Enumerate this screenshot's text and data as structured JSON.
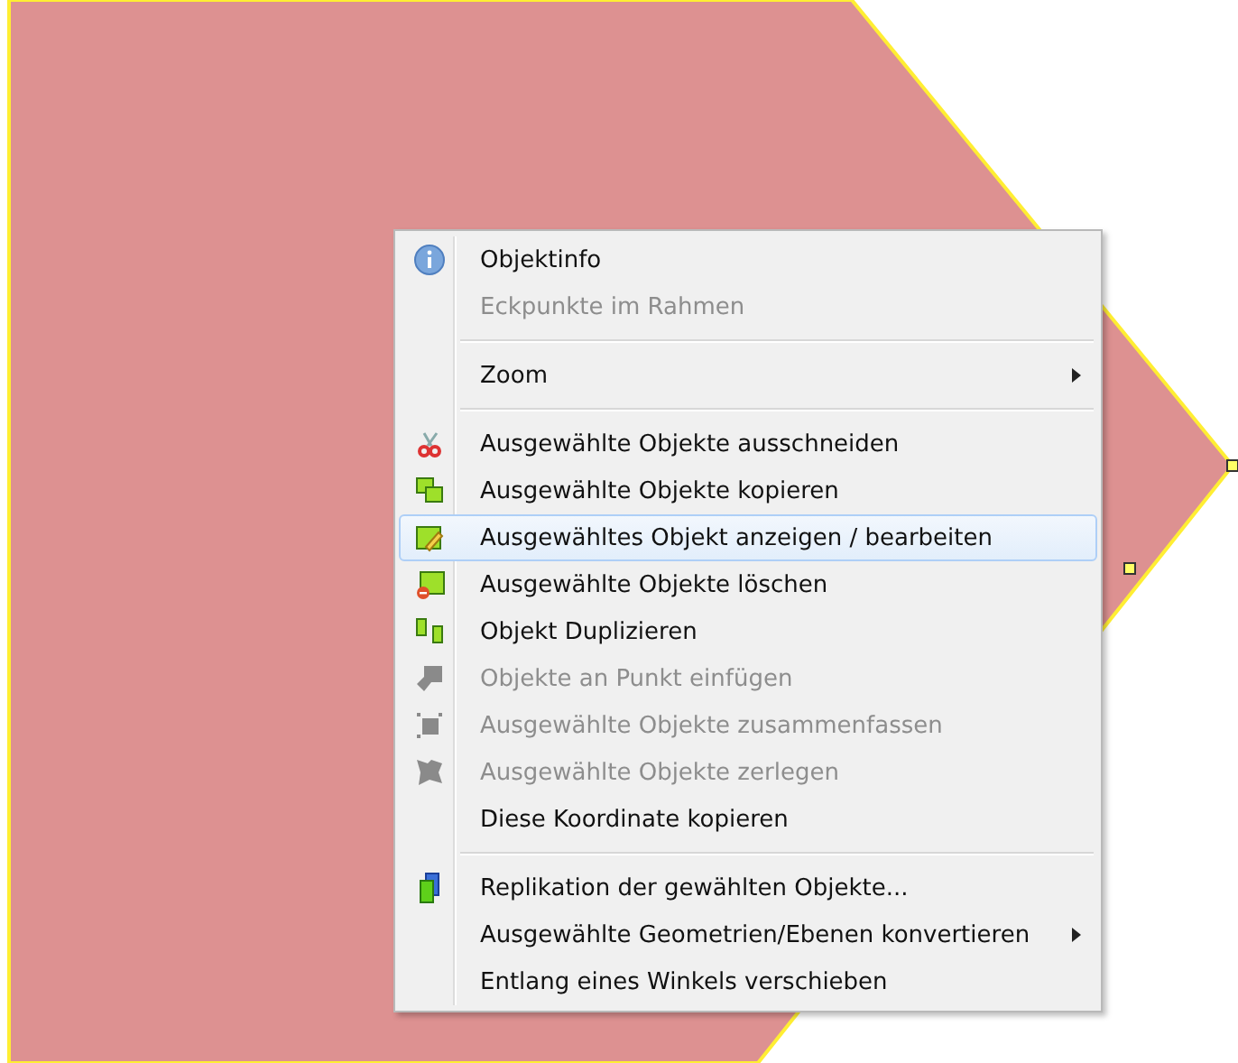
{
  "context_menu": {
    "items": [
      {
        "kind": "item",
        "label": "Objektinfo",
        "disabled": false,
        "selected": false,
        "submenu": false
      },
      {
        "kind": "item",
        "label": "Eckpunkte im Rahmen",
        "disabled": true,
        "selected": false,
        "submenu": false
      },
      {
        "kind": "separator"
      },
      {
        "kind": "item",
        "label": "Zoom",
        "disabled": false,
        "selected": false,
        "submenu": true
      },
      {
        "kind": "separator"
      },
      {
        "kind": "item",
        "label": "Ausgewählte Objekte ausschneiden",
        "disabled": false,
        "selected": false,
        "submenu": false
      },
      {
        "kind": "item",
        "label": "Ausgewählte Objekte kopieren",
        "disabled": false,
        "selected": false,
        "submenu": false
      },
      {
        "kind": "item",
        "label": "Ausgewähltes Objekt anzeigen / bearbeiten",
        "disabled": false,
        "selected": true,
        "submenu": false
      },
      {
        "kind": "item",
        "label": "Ausgewählte Objekte löschen",
        "disabled": false,
        "selected": false,
        "submenu": false
      },
      {
        "kind": "item",
        "label": "Objekt Duplizieren",
        "disabled": false,
        "selected": false,
        "submenu": false
      },
      {
        "kind": "item",
        "label": "Objekte an Punkt einfügen",
        "disabled": true,
        "selected": false,
        "submenu": false
      },
      {
        "kind": "item",
        "label": "Ausgewählte Objekte zusammenfassen",
        "disabled": true,
        "selected": false,
        "submenu": false
      },
      {
        "kind": "item",
        "label": "Ausgewählte Objekte zerlegen",
        "disabled": true,
        "selected": false,
        "submenu": false
      },
      {
        "kind": "item",
        "label": "Diese Koordinate kopieren",
        "disabled": false,
        "selected": false,
        "submenu": false
      },
      {
        "kind": "separator"
      },
      {
        "kind": "item",
        "label": "Replikation der gewählten Objekte...",
        "disabled": false,
        "selected": false,
        "submenu": false
      },
      {
        "kind": "item",
        "label": "Ausgewählte Geometrien/Ebenen konvertieren",
        "disabled": false,
        "selected": false,
        "submenu": true
      },
      {
        "kind": "item",
        "label": "Entlang eines Winkels verschieben",
        "disabled": false,
        "selected": false,
        "submenu": false
      }
    ]
  }
}
